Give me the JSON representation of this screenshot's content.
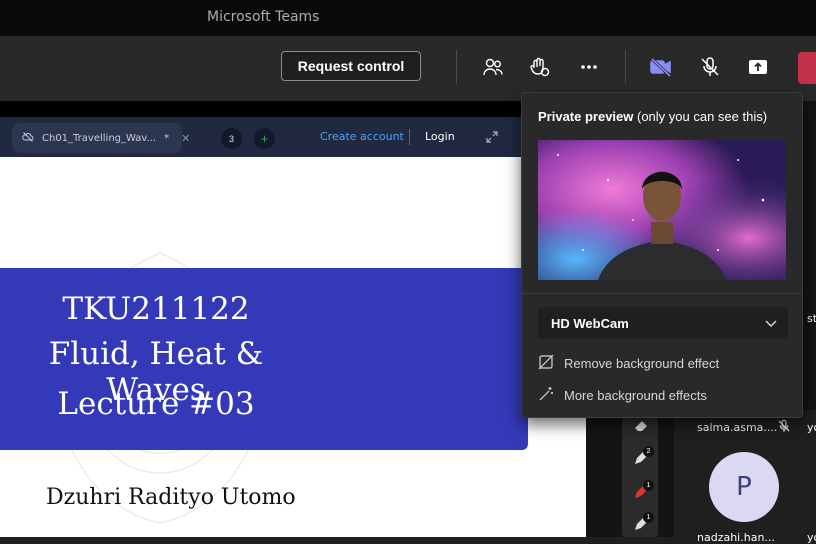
{
  "app": {
    "title": "Microsoft Teams"
  },
  "toolbar": {
    "request_control": "Request control",
    "icons": [
      "people-icon",
      "raise-hand-icon",
      "more-icon",
      "camera-icon",
      "mic-off-icon",
      "share-tray-icon",
      "leave-icon"
    ],
    "accent_color": "#8b8cf4",
    "leave_color": "#c4314b"
  },
  "browser": {
    "tab_label": "Ch01_Travelling_Wav...",
    "tab_dirty_mark": "*",
    "tab_count": "3",
    "new_tab": "+",
    "create_account": "Create account",
    "login": "Login"
  },
  "slide": {
    "course_code": "TKU211122",
    "course_name": "Fluid, Heat & Waves",
    "lecture": "Lecture #03",
    "author": "Dzuhri Radityo Utomo",
    "banner_color": "#3439b8"
  },
  "preview_popup": {
    "title_bold": "Private preview",
    "title_rest": " (only you can see this)",
    "camera": "HD WebCam",
    "remove_bg": "Remove background effect",
    "more_bg": "More background effects"
  },
  "participants": {
    "tile1_name": "salma.asma....",
    "tile1_suffix": "yo",
    "tile2_initial": "P",
    "tile2_name": "nadzahi.han...",
    "tile2_suffix": "yo",
    "top_suffix": "st"
  },
  "annotations": {
    "badges": [
      "2",
      "1",
      "1"
    ]
  }
}
